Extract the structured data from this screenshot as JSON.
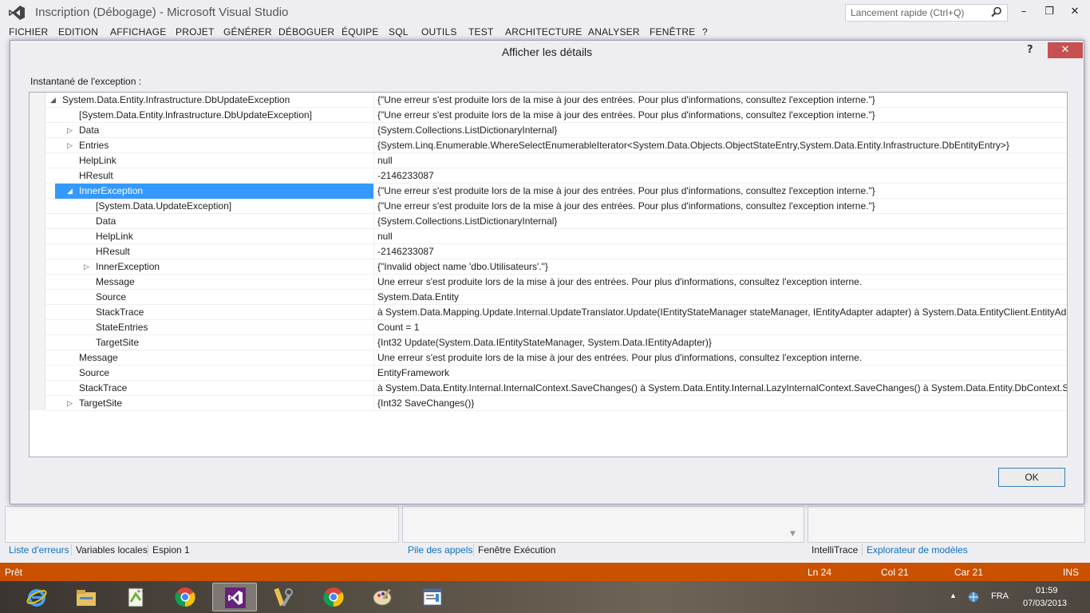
{
  "window": {
    "title": "Inscription (Débogage) - Microsoft Visual Studio",
    "quicklaunch_placeholder": "Lancement rapide (Ctrl+Q)",
    "controls": {
      "minimize": "–",
      "maximize": "❐",
      "close": "✕"
    }
  },
  "menu": [
    "FICHIER",
    "EDITION",
    "AFFICHAGE",
    "PROJET",
    "GÉNÉRER",
    "DÉBOGUER",
    "ÉQUIPE",
    "SQL",
    "OUTILS",
    "TEST",
    "ARCHITECTURE",
    "ANALYSER",
    "FENÊTRE",
    "?"
  ],
  "dialog": {
    "title": "Afficher les détails",
    "help": "?",
    "close": "✕",
    "snapshot_label": "Instantané de l'exception :",
    "ok_label": "OK",
    "rows": [
      {
        "name": "System.Data.Entity.Infrastructure.DbUpdateException",
        "value": "{\"Une erreur s'est produite lors de la mise à jour des entrées. Pour plus d'informations, consultez l'exception interne.\"}",
        "expander": "expanded",
        "depth": 0
      },
      {
        "name": "[System.Data.Entity.Infrastructure.DbUpdateException]",
        "value": "{\"Une erreur s'est produite lors de la mise à jour des entrées. Pour plus d'informations, consultez l'exception interne.\"}",
        "expander": "none",
        "depth": 1
      },
      {
        "name": "Data",
        "value": "{System.Collections.ListDictionaryInternal}",
        "expander": "collapsed",
        "depth": 1
      },
      {
        "name": "Entries",
        "value": "{System.Linq.Enumerable.WhereSelectEnumerableIterator<System.Data.Objects.ObjectStateEntry,System.Data.Entity.Infrastructure.DbEntityEntry>}",
        "expander": "collapsed",
        "depth": 1
      },
      {
        "name": "HelpLink",
        "value": "null",
        "expander": "none",
        "depth": 1
      },
      {
        "name": "HResult",
        "value": "-2146233087",
        "expander": "none",
        "depth": 1
      },
      {
        "name": "InnerException",
        "value": "{\"Une erreur s'est produite lors de la mise à jour des entrées. Pour plus d'informations, consultez l'exception interne.\"}",
        "expander": "expanded",
        "depth": 1,
        "selected": true
      },
      {
        "name": "[System.Data.UpdateException]",
        "value": "{\"Une erreur s'est produite lors de la mise à jour des entrées. Pour plus d'informations, consultez l'exception interne.\"}",
        "expander": "none",
        "depth": 2
      },
      {
        "name": "Data",
        "value": "{System.Collections.ListDictionaryInternal}",
        "expander": "none",
        "depth": 2
      },
      {
        "name": "HelpLink",
        "value": "null",
        "expander": "none",
        "depth": 2
      },
      {
        "name": "HResult",
        "value": "-2146233087",
        "expander": "none",
        "depth": 2
      },
      {
        "name": "InnerException",
        "value": "{\"Invalid object name 'dbo.Utilisateurs'.\"}",
        "expander": "collapsed",
        "depth": 2
      },
      {
        "name": "Message",
        "value": "Une erreur s'est produite lors de la mise à jour des entrées. Pour plus d'informations, consultez l'exception interne.",
        "expander": "none",
        "depth": 2
      },
      {
        "name": "Source",
        "value": "System.Data.Entity",
        "expander": "none",
        "depth": 2
      },
      {
        "name": "StackTrace",
        "value": "   à System.Data.Mapping.Update.Internal.UpdateTranslator.Update(IEntityStateManager stateManager, IEntityAdapter adapter)    à System.Data.EntityClient.EntityAdapter.Update",
        "expander": "none",
        "depth": 2
      },
      {
        "name": "StateEntries",
        "value": "Count = 1",
        "expander": "none",
        "depth": 2
      },
      {
        "name": "TargetSite",
        "value": "{Int32 Update(System.Data.IEntityStateManager, System.Data.IEntityAdapter)}",
        "expander": "none",
        "depth": 2
      },
      {
        "name": "Message",
        "value": "Une erreur s'est produite lors de la mise à jour des entrées. Pour plus d'informations, consultez l'exception interne.",
        "expander": "none",
        "depth": 1
      },
      {
        "name": "Source",
        "value": "EntityFramework",
        "expander": "none",
        "depth": 1
      },
      {
        "name": "StackTrace",
        "value": "   à System.Data.Entity.Internal.InternalContext.SaveChanges()    à System.Data.Entity.Internal.LazyInternalContext.SaveChanges()    à System.Data.Entity.DbContext.SaveChanges()",
        "expander": "none",
        "depth": 1
      },
      {
        "name": "TargetSite",
        "value": "{Int32 SaveChanges()}",
        "expander": "collapsed",
        "depth": 1
      }
    ]
  },
  "bottom_tabs": {
    "left": [
      "Liste d'erreurs",
      "Variables locales",
      "Espion 1"
    ],
    "mid": [
      "Pile des appels",
      "Fenêtre Exécution"
    ],
    "right": [
      "IntelliTrace",
      "Explorateur de modèles"
    ]
  },
  "status": {
    "state": "Prêt",
    "line": "Ln 24",
    "col": "Col 21",
    "car": "Car 21",
    "mode": "INS",
    "color": "#ca5100"
  },
  "taskbar": {
    "apps": [
      "internet-explorer-icon",
      "file-explorer-icon",
      "notepad-plus-icon",
      "chrome-icon",
      "visual-studio-icon",
      "tools-icon",
      "chrome-icon",
      "paint-icon",
      "window-app-icon"
    ],
    "language": "FRA",
    "time": "01:59",
    "date": "07/03/2013"
  }
}
